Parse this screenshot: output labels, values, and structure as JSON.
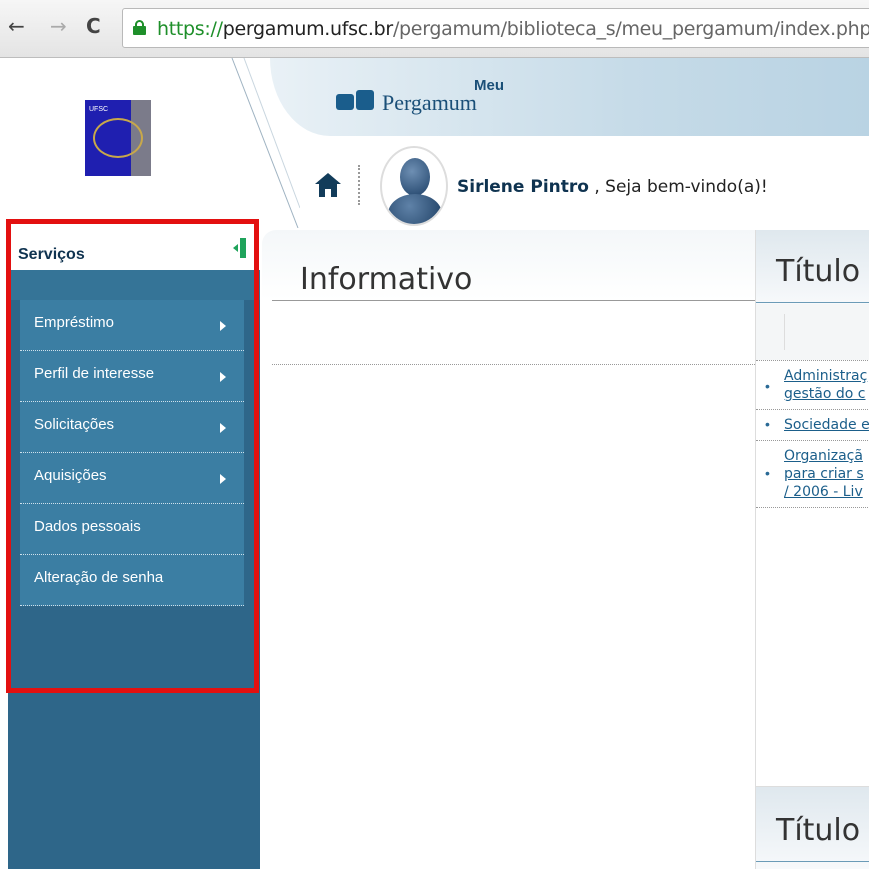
{
  "browser": {
    "url_scheme": "https://",
    "url_host": "pergamum.ufsc.br",
    "url_path": "/pergamum/biblioteca_s/meu_pergamum/index.php"
  },
  "header": {
    "logo_text": "UFSC",
    "brand_meu": "Meu",
    "brand_name": "Pergamum",
    "user_name": "Sirlene Pintro",
    "welcome_suffix": ", Seja bem-vindo(a)!"
  },
  "sidebar": {
    "title": "Serviços",
    "items": [
      {
        "label": "Empréstimo",
        "submenu": true
      },
      {
        "label": "Perfil de interesse",
        "submenu": true
      },
      {
        "label": "Solicitações",
        "submenu": true
      },
      {
        "label": "Aquisições",
        "submenu": true
      },
      {
        "label": "Dados pessoais",
        "submenu": false
      },
      {
        "label": "Alteração de senha",
        "submenu": false
      }
    ]
  },
  "main": {
    "informativo_title": "Informativo",
    "titulo_title": "Título",
    "titulo_list": [
      {
        "lines": [
          "Administraç",
          "gestão do c"
        ]
      },
      {
        "lines": [
          "Sociedade e"
        ]
      },
      {
        "lines": [
          "Organizaçã",
          "para criar s",
          "/ 2006 - Liv"
        ]
      }
    ],
    "titulo2_title": "Título"
  },
  "colors": {
    "sidebar_bg": "#2e6689",
    "menu_item_bg": "#3b7ea3",
    "highlight_border": "#e31010",
    "accent_green": "#1fa35b",
    "link_color": "#1b5e8a"
  },
  "icons": [
    "back-arrow-icon",
    "forward-arrow-icon",
    "reload-icon",
    "lock-icon",
    "home-icon",
    "user-avatar-icon",
    "chevron-right-icon"
  ]
}
